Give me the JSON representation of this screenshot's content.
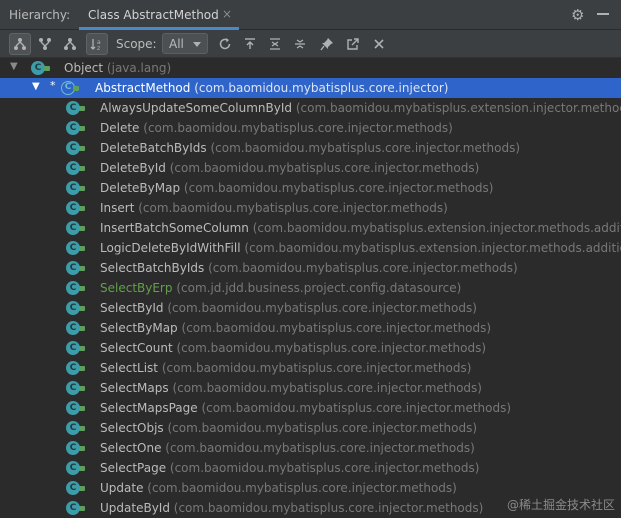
{
  "header": {
    "title": "Hierarchy:",
    "tab_label": "Class AbstractMethod",
    "tab_close": "×",
    "gear": "⚙"
  },
  "toolbar": {
    "scope_label": "Scope:",
    "scope_value": "All",
    "icons": [
      "type-hierarchy-icon",
      "supertypes-icon",
      "subtypes-icon",
      "sort-alpha-icon",
      "refresh-icon",
      "autoscroll-icon",
      "expand-all-icon",
      "collapse-all-icon",
      "pin-icon",
      "open-in-new-icon",
      "close-icon"
    ]
  },
  "tree": {
    "root": {
      "name": "Object",
      "pkg": "(java.lang)"
    },
    "selected": {
      "name": "AbstractMethod",
      "pkg": "(com.baomidou.mybatisplus.core.injector)"
    },
    "children": [
      {
        "name": "AlwaysUpdateSomeColumnById",
        "pkg": "(com.baomidou.mybatisplus.extension.injector.methods.a"
      },
      {
        "name": "Delete",
        "pkg": "(com.baomidou.mybatisplus.core.injector.methods)"
      },
      {
        "name": "DeleteBatchByIds",
        "pkg": "(com.baomidou.mybatisplus.core.injector.methods)"
      },
      {
        "name": "DeleteById",
        "pkg": "(com.baomidou.mybatisplus.core.injector.methods)"
      },
      {
        "name": "DeleteByMap",
        "pkg": "(com.baomidou.mybatisplus.core.injector.methods)"
      },
      {
        "name": "Insert",
        "pkg": "(com.baomidou.mybatisplus.core.injector.methods)"
      },
      {
        "name": "InsertBatchSomeColumn",
        "pkg": "(com.baomidou.mybatisplus.extension.injector.methods.additio"
      },
      {
        "name": "LogicDeleteByIdWithFill",
        "pkg": "(com.baomidou.mybatisplus.extension.injector.methods.additiona"
      },
      {
        "name": "SelectBatchByIds",
        "pkg": "(com.baomidou.mybatisplus.core.injector.methods)"
      },
      {
        "name": "SelectByErp",
        "pkg": "(com.jd.jdd.business.project.config.datasource)",
        "highlight": "green"
      },
      {
        "name": "SelectById",
        "pkg": "(com.baomidou.mybatisplus.core.injector.methods)"
      },
      {
        "name": "SelectByMap",
        "pkg": "(com.baomidou.mybatisplus.core.injector.methods)"
      },
      {
        "name": "SelectCount",
        "pkg": "(com.baomidou.mybatisplus.core.injector.methods)"
      },
      {
        "name": "SelectList",
        "pkg": "(com.baomidou.mybatisplus.core.injector.methods)"
      },
      {
        "name": "SelectMaps",
        "pkg": "(com.baomidou.mybatisplus.core.injector.methods)"
      },
      {
        "name": "SelectMapsPage",
        "pkg": "(com.baomidou.mybatisplus.core.injector.methods)"
      },
      {
        "name": "SelectObjs",
        "pkg": "(com.baomidou.mybatisplus.core.injector.methods)"
      },
      {
        "name": "SelectOne",
        "pkg": "(com.baomidou.mybatisplus.core.injector.methods)"
      },
      {
        "name": "SelectPage",
        "pkg": "(com.baomidou.mybatisplus.core.injector.methods)"
      },
      {
        "name": "Update",
        "pkg": "(com.baomidou.mybatisplus.core.injector.methods)"
      },
      {
        "name": "UpdateById",
        "pkg": "(com.baomidou.mybatisplus.core.injector.methods)"
      }
    ]
  },
  "watermark": "@稀土掘金技术社区",
  "colors": {
    "selection": "#2f65ca",
    "class_icon": "#3d9ca8",
    "green_text": "#62a049",
    "tab_underline": "#4a88c7"
  }
}
